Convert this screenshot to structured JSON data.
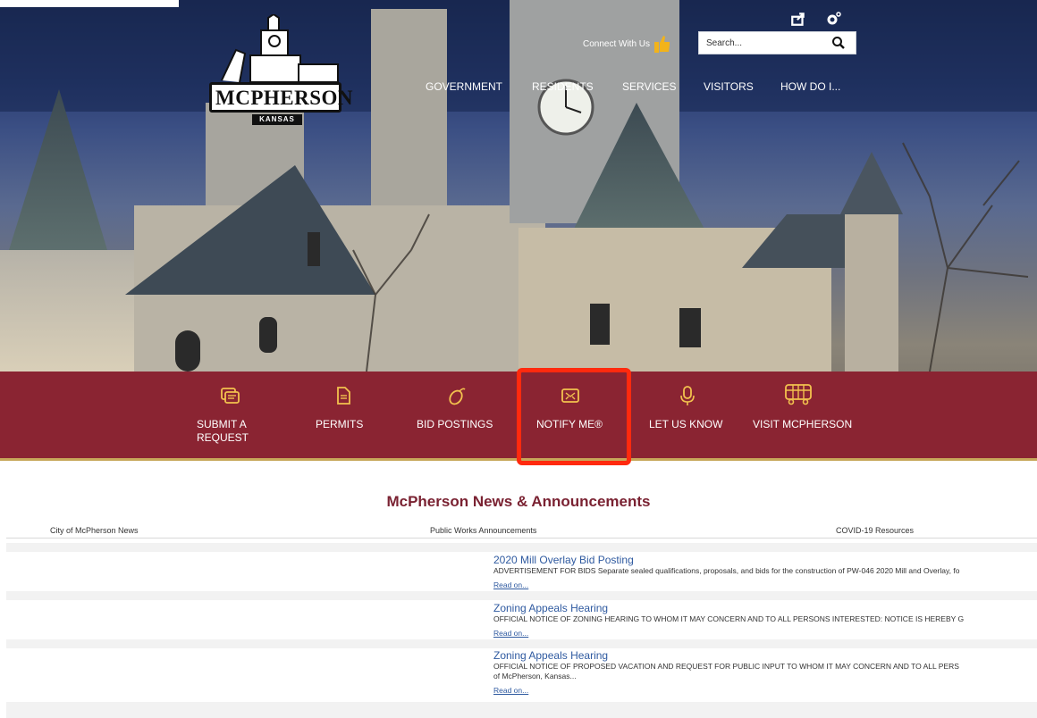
{
  "header": {
    "top_note": "",
    "connect_label": "Connect With Us",
    "search_placeholder": "Search...",
    "logo_word": "MCPHERSON",
    "logo_sub": "KANSAS",
    "icons": [
      "share-icon",
      "settings-icon",
      "thumbs-up-icon",
      "search-icon"
    ]
  },
  "nav": {
    "items": [
      "GOVERNMENT",
      "RESIDENTS",
      "SERVICES",
      "VISITORS",
      "HOW DO I..."
    ]
  },
  "quick_links": [
    {
      "label_line1": "SUBMIT A",
      "label_line2": "REQUEST",
      "icon": "speech-bubble-icon"
    },
    {
      "label_line1": "PERMITS",
      "label_line2": "",
      "icon": "document-icon"
    },
    {
      "label_line1": "BID POSTINGS",
      "label_line2": "",
      "icon": "mouse-icon"
    },
    {
      "label_line1": "NOTIFY ME®",
      "label_line2": "",
      "icon": "envelope-icon"
    },
    {
      "label_line1": "LET US KNOW",
      "label_line2": "",
      "icon": "microphone-icon"
    },
    {
      "label_line1": "VISIT MCPHERSON",
      "label_line2": "",
      "icon": "trolley-icon"
    }
  ],
  "colors": {
    "band": "#8a2432",
    "highlight": "#ff2a0e",
    "title": "#7a2232",
    "link": "#2f5aa0",
    "gold": "#c7a75a"
  },
  "news": {
    "title": "McPherson News & Announcements",
    "tabs": [
      "City of McPherson News",
      "Public Works Announcements",
      "COVID-19 Resources"
    ],
    "items": [
      {
        "headline": "2020 Mill Overlay Bid Posting",
        "excerpt": "ADVERTISEMENT FOR BIDS Separate sealed qualifications, proposals, and bids for the construction of PW-046 2020 Mill and Overlay, fo",
        "excerpt2": "",
        "read_on": "Read on..."
      },
      {
        "headline": "Zoning Appeals Hearing",
        "excerpt": "OFFICIAL NOTICE OF ZONING HEARING TO WHOM IT MAY CONCERN AND TO ALL PERSONS INTERESTED: NOTICE IS HEREBY G",
        "excerpt2": "",
        "read_on": "Read on..."
      },
      {
        "headline": "Zoning Appeals Hearing",
        "excerpt": "OFFICIAL NOTICE OF PROPOSED VACATION AND REQUEST FOR PUBLIC INPUT TO WHOM IT MAY CONCERN AND TO ALL PERS",
        "excerpt2": "of McPherson, Kansas...",
        "read_on": "Read on..."
      }
    ]
  }
}
